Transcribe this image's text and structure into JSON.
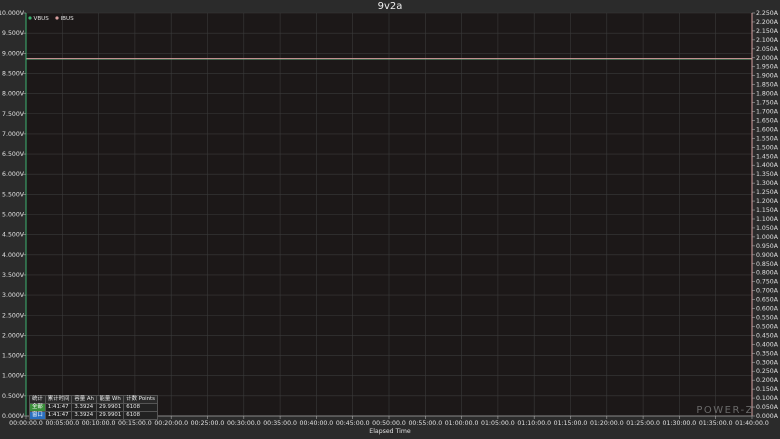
{
  "chart_data": {
    "type": "line",
    "title": "9v2a",
    "xlabel": "Elapsed Time",
    "x_ticks": [
      "00:00:00.0",
      "00:05:00.0",
      "00:10:00.0",
      "00:15:00.0",
      "00:20:00.0",
      "00:25:00.0",
      "00:30:00.0",
      "00:35:00.0",
      "00:40:00.0",
      "00:45:00.0",
      "00:50:00.0",
      "00:55:00.0",
      "01:00:00.0",
      "01:05:00.0",
      "01:10:00.0",
      "01:15:00.0",
      "01:20:00.0",
      "01:25:00.0",
      "01:30:00.0",
      "01:35:00.0",
      "01:40:00.0"
    ],
    "xlim_minutes": [
      0,
      100
    ],
    "y_left": {
      "unit": "V",
      "ylim": [
        0,
        10
      ],
      "ticks": [
        "0.000V",
        "0.500V",
        "1.000V",
        "1.500V",
        "2.000V",
        "2.500V",
        "3.000V",
        "3.500V",
        "4.000V",
        "4.500V",
        "5.000V",
        "5.500V",
        "6.000V",
        "6.500V",
        "7.000V",
        "7.500V",
        "8.000V",
        "8.500V",
        "9.000V",
        "9.500V",
        "10.000V"
      ]
    },
    "y_right": {
      "unit": "A",
      "ylim": [
        0,
        2.25
      ],
      "ticks": [
        "0.000A",
        "0.050A",
        "0.100A",
        "0.150A",
        "0.200A",
        "0.250A",
        "0.300A",
        "0.350A",
        "0.400A",
        "0.450A",
        "0.500A",
        "0.550A",
        "0.600A",
        "0.650A",
        "0.700A",
        "0.750A",
        "0.800A",
        "0.850A",
        "0.900A",
        "0.950A",
        "1.000A",
        "1.050A",
        "1.100A",
        "1.150A",
        "1.200A",
        "1.250A",
        "1.300A",
        "1.350A",
        "1.400A",
        "1.450A",
        "1.500A",
        "1.550A",
        "1.600A",
        "1.650A",
        "1.700A",
        "1.750A",
        "1.800A",
        "1.850A",
        "1.900A",
        "1.950A",
        "2.000A",
        "2.050A",
        "2.100A",
        "2.150A",
        "2.200A",
        "2.250A"
      ]
    },
    "grid": true,
    "legend": "top-left",
    "series": [
      {
        "name": "VBUS",
        "axis": "left",
        "color": "#3cb371",
        "x": [
          0,
          101.78
        ],
        "values": [
          8.86,
          8.86
        ]
      },
      {
        "name": "IBUS",
        "axis": "right",
        "color": "#d9a0a0",
        "x": [
          0,
          101.78
        ],
        "values": [
          1.995,
          1.995
        ]
      }
    ]
  },
  "stats": {
    "headers": [
      "统计",
      "累计时间",
      "容量 Ah",
      "能量 Wh",
      "计数 Points"
    ],
    "rows": [
      {
        "tag": "全部",
        "time": "1:41:47",
        "ah": "3.3924",
        "wh": "29.9901",
        "points": "6108"
      },
      {
        "tag": "窗口",
        "time": "1:41:47",
        "ah": "3.3924",
        "wh": "29.9901",
        "points": "6108"
      }
    ]
  },
  "brand": "POWER-Z"
}
